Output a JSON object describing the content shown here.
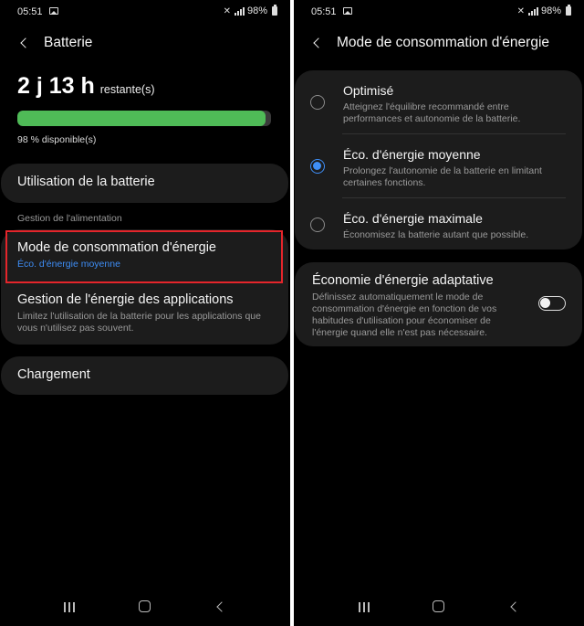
{
  "status": {
    "time": "05:51",
    "battery_text": "98%"
  },
  "left": {
    "header_title": "Batterie",
    "remaining_value": "2 j 13 h",
    "remaining_label": "restante(s)",
    "battery_level": 0.98,
    "available_text": "98 % disponible(s)",
    "usage_label": "Utilisation de la batterie",
    "section_title": "Gestion de l'alimentation",
    "power_mode_label": "Mode de consommation d'énergie",
    "power_mode_value": "Éco. d'énergie moyenne",
    "app_power_label": "Gestion de l'énergie des applications",
    "app_power_desc": "Limitez l'utilisation de la batterie pour les applications que vous n'utilisez pas souvent.",
    "charging_label": "Chargement"
  },
  "right": {
    "header_title": "Mode de consommation d'énergie",
    "options": [
      {
        "label": "Optimisé",
        "desc": "Atteignez l'équilibre recommandé entre performances et autonomie de la batterie.",
        "selected": false
      },
      {
        "label": "Éco. d'énergie moyenne",
        "desc": "Prolongez l'autonomie de la batterie en limitant certaines fonctions.",
        "selected": true
      },
      {
        "label": "Éco. d'énergie maximale",
        "desc": "Économisez la batterie autant que possible.",
        "selected": false
      }
    ],
    "adaptive_label": "Économie d'énergie adaptative",
    "adaptive_desc": "Définissez automatiquement le mode de consommation d'énergie en fonction de vos habitudes d'utilisation pour économiser de l'énergie quand elle n'est pas nécessaire.",
    "adaptive_enabled": false
  },
  "colors": {
    "accent": "#3e8ef7",
    "battery_fill": "#4fbb57",
    "highlight": "#e4252b",
    "card": "#1c1c1c"
  }
}
